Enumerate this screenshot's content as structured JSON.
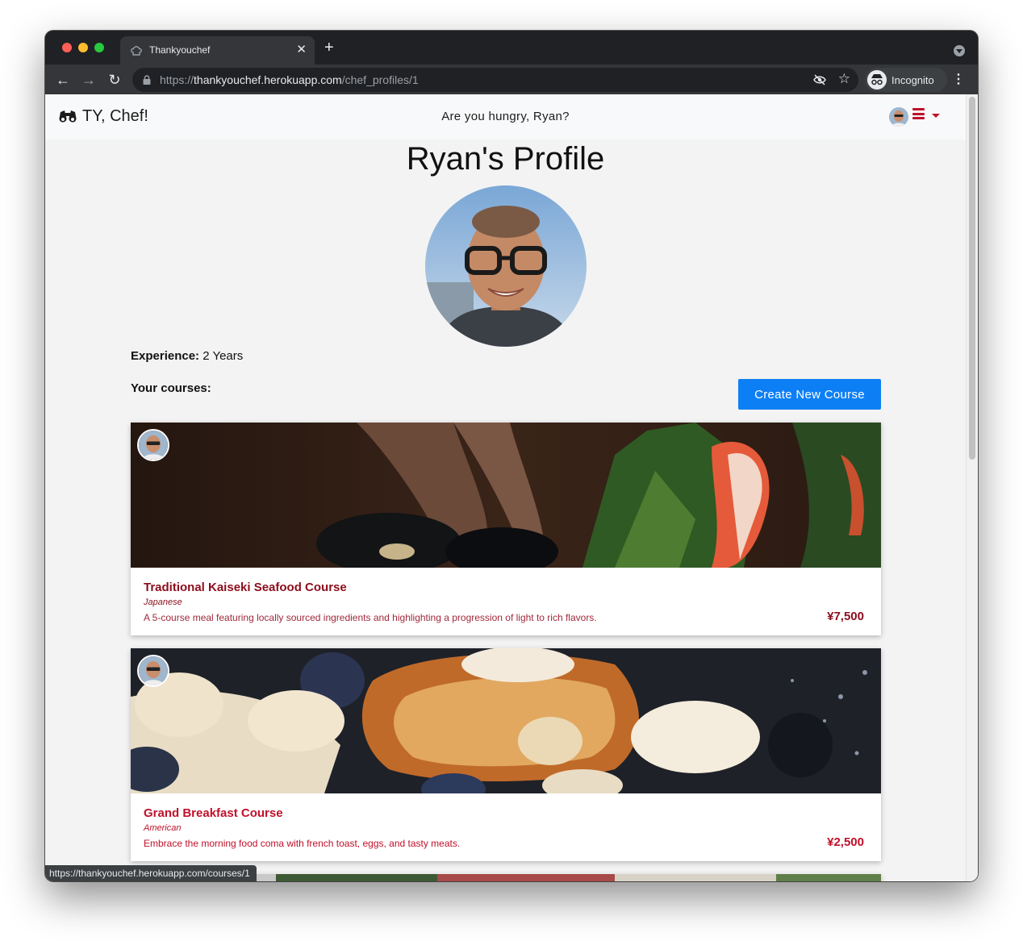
{
  "browser": {
    "tab_title": "Thankyouchef",
    "tab_close": "✕",
    "new_tab": "+",
    "url_scheme": "https://",
    "url_host": "thankyouchef.herokuapp.com",
    "url_path": "/chef_profiles/1",
    "incognito_label": "Incognito",
    "status_url": "https://thankyouchef.herokuapp.com/courses/1"
  },
  "navbar": {
    "brand": "TY, Chef!",
    "greeting": "Are you hungry, Ryan?"
  },
  "profile": {
    "title": "Ryan's Profile",
    "experience_label": "Experience:",
    "experience_value": "2 Years",
    "courses_heading": "Your courses:",
    "create_button": "Create New Course"
  },
  "courses": [
    {
      "title": "Traditional Kaiseki Seafood Course",
      "cuisine": "Japanese",
      "description": "A 5-course meal featuring locally sourced ingredients and highlighting a progression of light to rich flavors.",
      "price": "¥7,500"
    },
    {
      "title": "Grand Breakfast Course",
      "cuisine": "American",
      "description": "Embrace the morning food coma with french toast, eggs, and tasty meats.",
      "price": "¥2,500"
    }
  ],
  "colors": {
    "accent_red": "#c0102a",
    "button_blue": "#0d7ff5"
  }
}
